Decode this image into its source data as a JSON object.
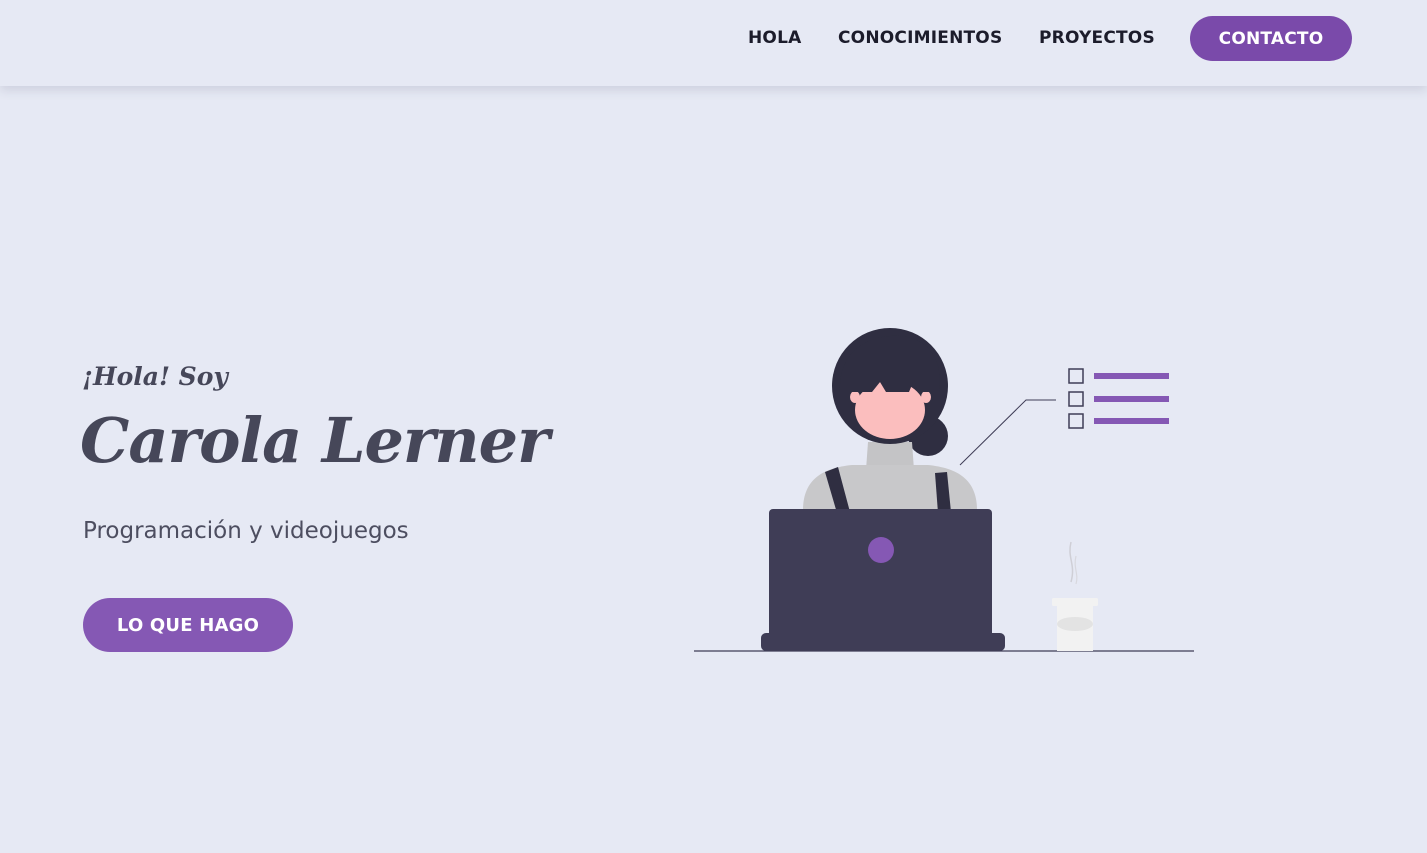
{
  "nav": {
    "items": [
      {
        "label": "HOLA"
      },
      {
        "label": "CONOCIMIENTOS"
      },
      {
        "label": "PROYECTOS"
      }
    ],
    "contact_label": "CONTACTO"
  },
  "hero": {
    "greeting": "¡Hola! Soy",
    "name": "Carola Lerner",
    "subtitle": "Programación y videojuegos",
    "button_label": "LO QUE HAGO"
  },
  "illustration": {
    "icon": "woman-at-laptop-illustration"
  },
  "colors": {
    "background": "#e6e9f4",
    "accent": "#7a4aaa",
    "button": "#8558b4",
    "text_dark": "#464759",
    "laptop": "#3f3d56"
  }
}
